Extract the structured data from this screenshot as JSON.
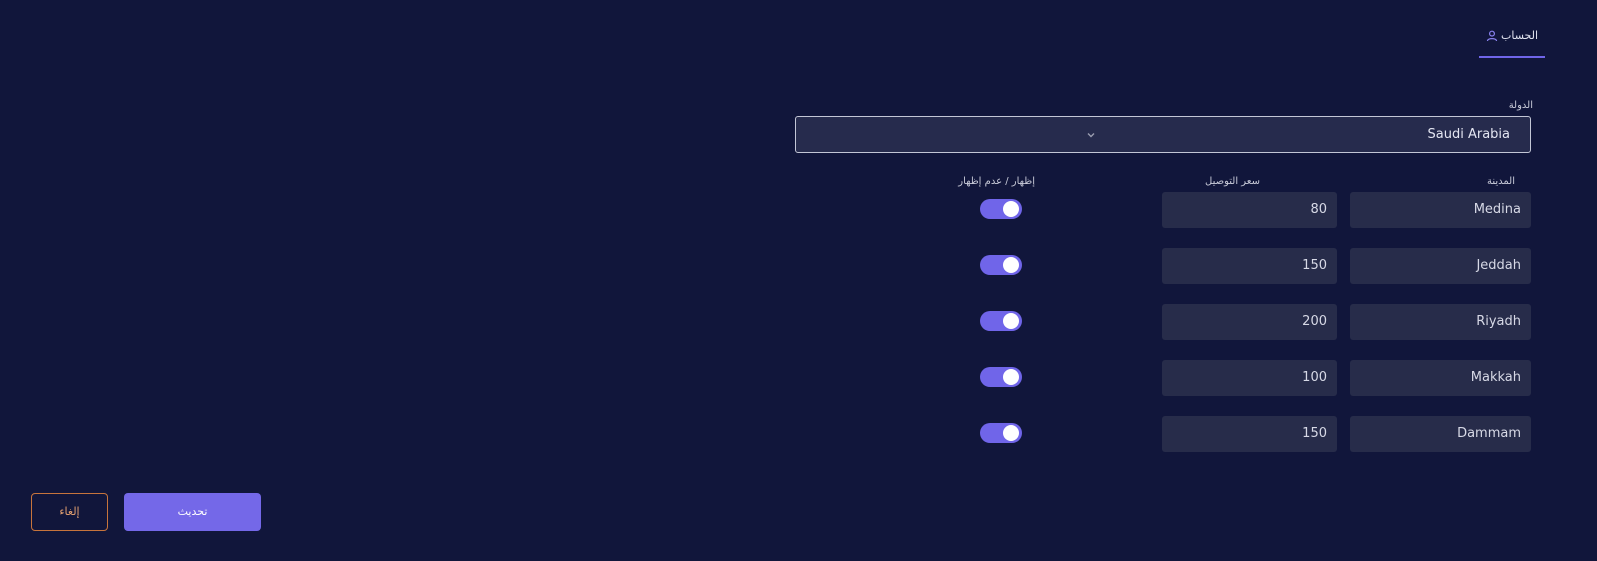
{
  "tabs": {
    "account_label": "الحساب",
    "account_icon": "user-icon"
  },
  "country": {
    "label": "الدولة",
    "value": "Saudi Arabia",
    "icon": "chevron-down-icon"
  },
  "columns": {
    "city": "المدينة",
    "price": "سعر التوصيل",
    "toggle": "إظهار / عدم إظهار"
  },
  "rows": [
    {
      "city": "Medina",
      "price": "80",
      "visible": true
    },
    {
      "city": "Jeddah",
      "price": "150",
      "visible": true
    },
    {
      "city": "Riyadh",
      "price": "200",
      "visible": true
    },
    {
      "city": "Makkah",
      "price": "100",
      "visible": true
    },
    {
      "city": "Dammam",
      "price": "150",
      "visible": true
    }
  ],
  "actions": {
    "update_label": "تحديث",
    "cancel_label": "إلغاء"
  },
  "colors": {
    "background": "#11163b",
    "accent": "#7065e9",
    "cancel_border": "#c7743c"
  }
}
